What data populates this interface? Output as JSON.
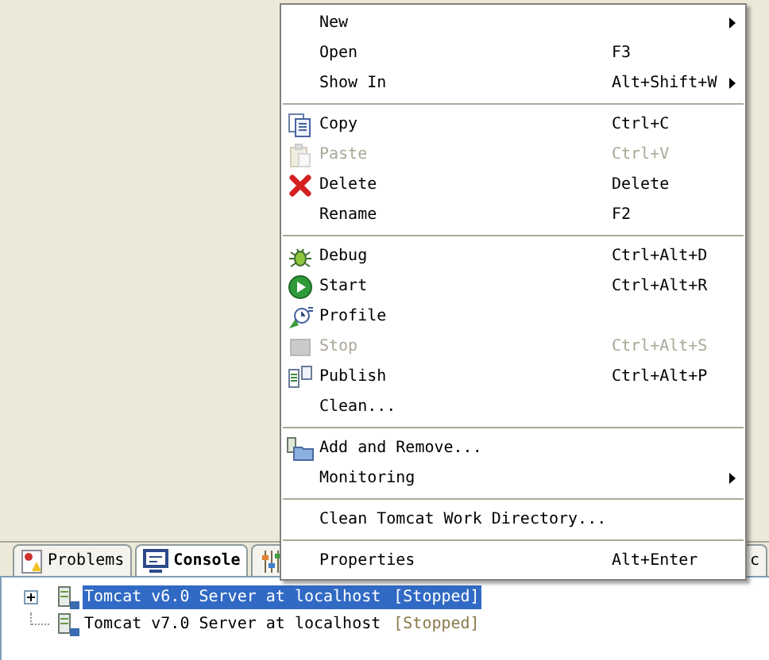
{
  "menu": {
    "items": [
      {
        "kind": "item",
        "label": "New",
        "submenu": true
      },
      {
        "kind": "item",
        "label": "Open",
        "shortcut": "F3"
      },
      {
        "kind": "item",
        "label": "Show In",
        "shortcut": "Alt+Shift+W",
        "submenu": true
      },
      {
        "kind": "separator"
      },
      {
        "kind": "item",
        "label": "Copy",
        "shortcut": "Ctrl+C"
      },
      {
        "kind": "item",
        "label": "Paste",
        "shortcut": "Ctrl+V",
        "disabled": true
      },
      {
        "kind": "item",
        "label": "Delete",
        "shortcut": "Delete"
      },
      {
        "kind": "item",
        "label": "Rename",
        "shortcut": "F2"
      },
      {
        "kind": "separator"
      },
      {
        "kind": "item",
        "label": "Debug",
        "shortcut": "Ctrl+Alt+D"
      },
      {
        "kind": "item",
        "label": "Start",
        "shortcut": "Ctrl+Alt+R"
      },
      {
        "kind": "item",
        "label": "Profile"
      },
      {
        "kind": "item",
        "label": "Stop",
        "shortcut": "Ctrl+Alt+S",
        "disabled": true
      },
      {
        "kind": "item",
        "label": "Publish",
        "shortcut": "Ctrl+Alt+P"
      },
      {
        "kind": "item",
        "label": "Clean..."
      },
      {
        "kind": "separator"
      },
      {
        "kind": "item",
        "label": "Add and Remove..."
      },
      {
        "kind": "item",
        "label": "Monitoring",
        "submenu": true
      },
      {
        "kind": "separator"
      },
      {
        "kind": "item",
        "label": "Clean Tomcat Work Directory..."
      },
      {
        "kind": "separator"
      },
      {
        "kind": "item",
        "label": "Properties",
        "shortcut": "Alt+Enter"
      }
    ]
  },
  "tabs": [
    {
      "label": "Problems",
      "selected": false
    },
    {
      "label": "Console",
      "selected": true
    },
    {
      "selected": false
    },
    {
      "label": "c",
      "selected": false
    }
  ],
  "servers": [
    {
      "name": "Tomcat v6.0 Server at localhost",
      "status": "[Stopped]",
      "selected": true,
      "expandable": true
    },
    {
      "name": "Tomcat v7.0 Server at localhost",
      "status": "[Stopped]",
      "selected": false,
      "expandable": false
    }
  ]
}
